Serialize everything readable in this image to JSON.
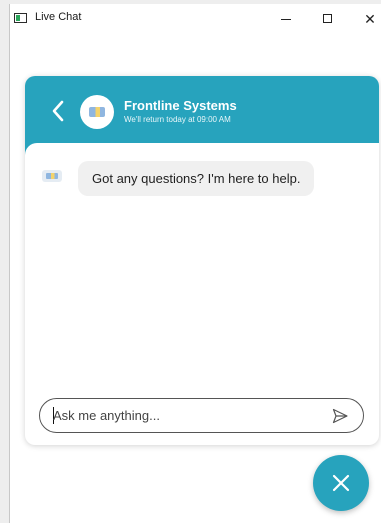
{
  "window": {
    "title": "Live Chat",
    "controls": {
      "minimize": "—",
      "maximize": "☐",
      "close": "✕"
    }
  },
  "chat": {
    "company_name": "Frontline Systems",
    "status_text": "We'll return today at 09:00 AM",
    "messages": [
      {
        "from": "agent",
        "text": "Got any questions? I'm here to help."
      }
    ],
    "input": {
      "value": "",
      "placeholder": "Ask me anything..."
    }
  },
  "colors": {
    "accent": "#27a3bd",
    "bubble_bg": "#f0f0f0"
  },
  "icons": {
    "back": "chevron-left-icon",
    "send": "paper-plane-icon",
    "fab": "close-icon"
  }
}
